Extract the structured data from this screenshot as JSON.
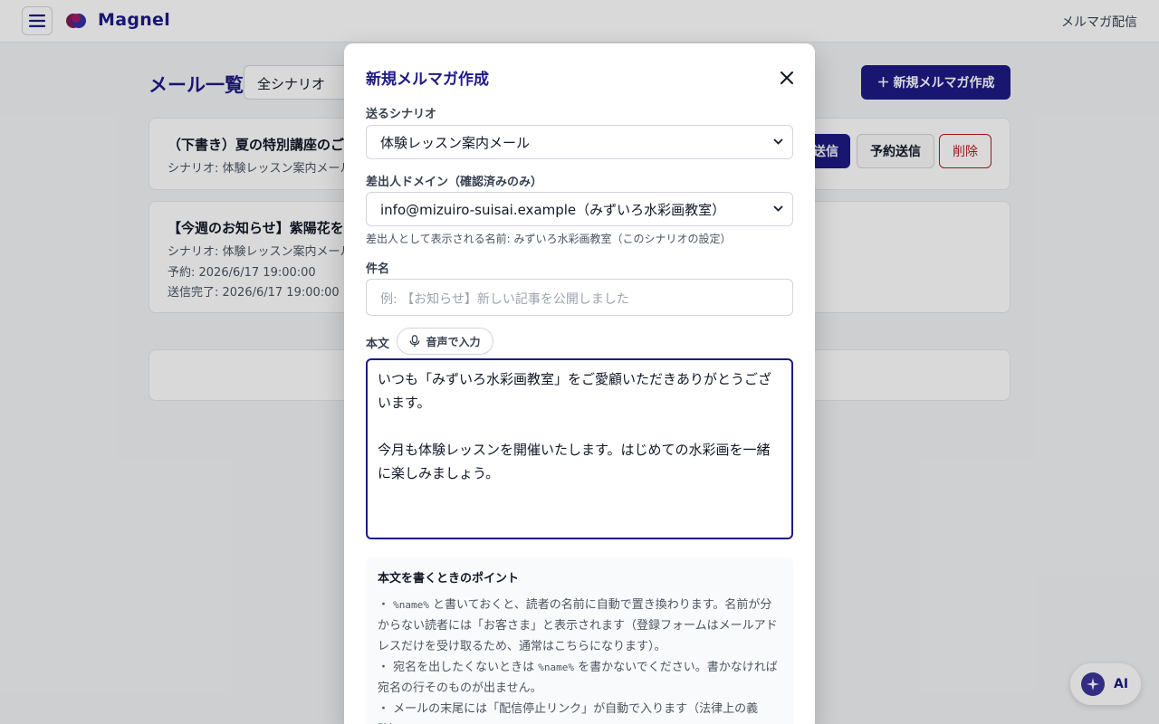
{
  "header": {
    "brand": "Magnel",
    "right_link": "メルマガ配信"
  },
  "main": {
    "title": "メール一覧",
    "scenario_filter": "全シナリオ",
    "new_button": "新規メルマガ作成",
    "cards": [
      {
        "title": "（下書き）夏の特別講座のご",
        "scenario": "シナリオ: 体験レッスン案内メール",
        "send_label": "送信",
        "schedule_label": "予約送信",
        "delete_label": "削除"
      },
      {
        "title": "【今週のお知らせ】紫陽花を",
        "scenario": "シナリオ: 体験レッスン案内メール",
        "reserved": "予約: 2026/6/17 19:00:00",
        "sent": "送信完了: 2026/6/17 19:00:00"
      }
    ]
  },
  "ai_button": {
    "label": "AI"
  },
  "modal": {
    "title": "新規メルマガ作成",
    "scenario_label": "送るシナリオ",
    "scenario_value": "体験レッスン案内メール",
    "domain_label": "差出人ドメイン（確認済みのみ）",
    "domain_value": "info@mizuiro-suisai.example（みずいろ水彩画教室）",
    "sender_hint": "差出人として表示される名前: みずいろ水彩画教室（このシナリオの設定）",
    "subject_label": "件名",
    "subject_placeholder": "例: 【お知らせ】新しい記事を公開しました",
    "body_label": "本文",
    "voice_button": "音声で入力",
    "body_line1": "いつも「みずいろ水彩画教室」をご愛顧いただきありがとうございます。",
    "body_line2": "今月も体験レッスンを開催いたします。はじめての水彩画を一緒に楽しみましょう。",
    "tips_title": "本文を書くときのポイント",
    "tip1_prefix": "・ ",
    "tip1_code": "%name%",
    "tip1_text": " と書いておくと、読者の名前に自動で置き換わります。名前が分からない読者には「お客さま」と表示されます（登録フォームはメールアドレスだけを受け取るため、通常はこちらになります）。",
    "tip2_prefix": "・ 宛名を出したくないときは ",
    "tip2_code": "%name%",
    "tip2_text": " を書かないでください。書かなければ宛名の行そのものが出ません。",
    "tip3": "・ メールの末尾には「配信停止リンク」が自動で入ります（法律上の義務）。"
  },
  "colors": {
    "brand_navy": "#1e1b87",
    "danger": "#b91c1c"
  }
}
